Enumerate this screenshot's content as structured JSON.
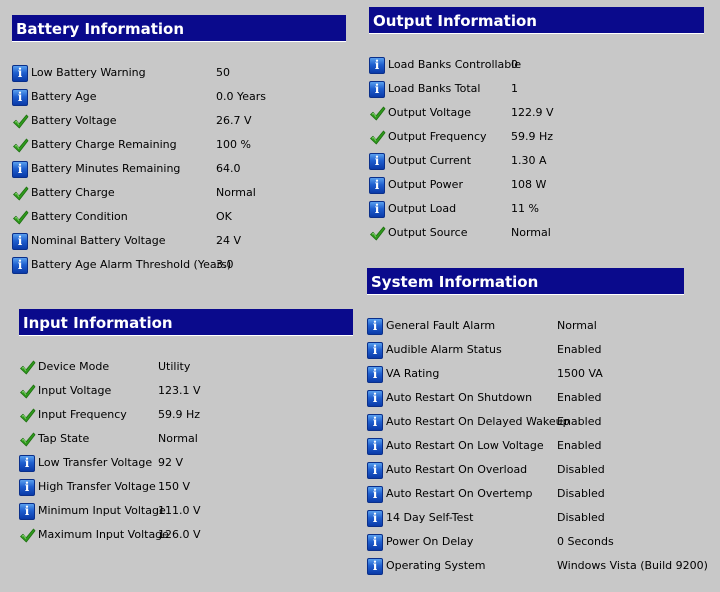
{
  "battery": {
    "title": "Battery Information",
    "rows": [
      {
        "icon": "info",
        "label": "Low Battery Warning",
        "value": "50"
      },
      {
        "icon": "info",
        "label": "Battery Age",
        "value": "0.0 Years"
      },
      {
        "icon": "check",
        "label": "Battery Voltage",
        "value": "26.7 V"
      },
      {
        "icon": "check",
        "label": "Battery Charge Remaining",
        "value": "100 %"
      },
      {
        "icon": "info",
        "label": "Battery Minutes Remaining",
        "value": "64.0"
      },
      {
        "icon": "check",
        "label": "Battery Charge",
        "value": "Normal"
      },
      {
        "icon": "check",
        "label": "Battery Condition",
        "value": "OK"
      },
      {
        "icon": "info",
        "label": "Nominal Battery Voltage",
        "value": "24 V"
      },
      {
        "icon": "info",
        "label": "Battery Age Alarm Threshold (Years)",
        "value": "3.0"
      }
    ]
  },
  "output": {
    "title": "Output Information",
    "rows": [
      {
        "icon": "info",
        "label": "Load Banks Controllable",
        "value": "0"
      },
      {
        "icon": "info",
        "label": "Load Banks Total",
        "value": "1"
      },
      {
        "icon": "check",
        "label": "Output Voltage",
        "value": "122.9 V"
      },
      {
        "icon": "check",
        "label": "Output Frequency",
        "value": "59.9 Hz"
      },
      {
        "icon": "info",
        "label": "Output Current",
        "value": "1.30 A"
      },
      {
        "icon": "info",
        "label": "Output Power",
        "value": "108 W"
      },
      {
        "icon": "info",
        "label": "Output Load",
        "value": "11 %"
      },
      {
        "icon": "check",
        "label": "Output Source",
        "value": "Normal"
      }
    ]
  },
  "input": {
    "title": "Input Information",
    "rows": [
      {
        "icon": "check",
        "label": "Device Mode",
        "value": "Utility"
      },
      {
        "icon": "check",
        "label": "Input Voltage",
        "value": "123.1 V"
      },
      {
        "icon": "check",
        "label": "Input Frequency",
        "value": "59.9 Hz"
      },
      {
        "icon": "check",
        "label": "Tap State",
        "value": "Normal"
      },
      {
        "icon": "info",
        "label": "Low Transfer Voltage",
        "value": "92 V"
      },
      {
        "icon": "info",
        "label": "High Transfer Voltage",
        "value": "150 V"
      },
      {
        "icon": "info",
        "label": "Minimum Input Voltage",
        "value": "111.0 V"
      },
      {
        "icon": "check",
        "label": "Maximum Input Voltage",
        "value": "126.0 V"
      }
    ]
  },
  "system": {
    "title": "System Information",
    "rows": [
      {
        "icon": "info",
        "label": "General Fault Alarm",
        "value": "Normal"
      },
      {
        "icon": "info",
        "label": "Audible Alarm Status",
        "value": "Enabled"
      },
      {
        "icon": "info",
        "label": "VA Rating",
        "value": "1500 VA"
      },
      {
        "icon": "info",
        "label": "Auto Restart On Shutdown",
        "value": "Enabled"
      },
      {
        "icon": "info",
        "label": "Auto Restart On Delayed Wakeup",
        "value": "Enabled"
      },
      {
        "icon": "info",
        "label": "Auto Restart On Low Voltage",
        "value": "Enabled"
      },
      {
        "icon": "info",
        "label": "Auto Restart On Overload",
        "value": "Disabled"
      },
      {
        "icon": "info",
        "label": "Auto Restart On Overtemp",
        "value": "Disabled"
      },
      {
        "icon": "info",
        "label": "14 Day Self-Test",
        "value": "Disabled"
      },
      {
        "icon": "info",
        "label": "Power On Delay",
        "value": "0 Seconds"
      },
      {
        "icon": "info",
        "label": "Operating System",
        "value": "Windows Vista  (Build 9200)"
      }
    ]
  },
  "icons": {
    "info": "info-icon",
    "check": "checkmark-icon"
  },
  "colors": {
    "header_bg": "#0a0a8c",
    "page_bg": "#c8c8c8",
    "check_green": "#2f9a1c",
    "info_blue": "#1f5fcf"
  }
}
